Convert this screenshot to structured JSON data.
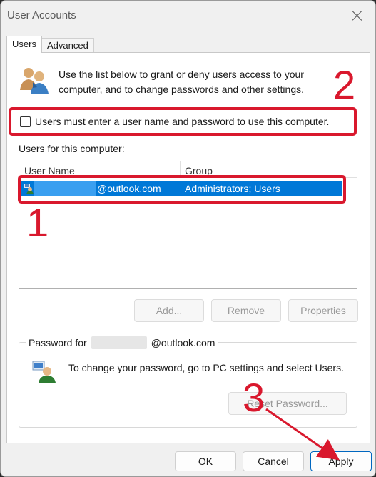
{
  "window": {
    "title": "User Accounts"
  },
  "tabs": [
    {
      "label": "Users",
      "active": true
    },
    {
      "label": "Advanced",
      "active": false
    }
  ],
  "intro_text": "Use the list below to grant or deny users access to your computer, and to change passwords and other settings.",
  "checkbox": {
    "label": "Users must enter a user name and password to use this computer.",
    "checked": false
  },
  "users_label": "Users for this computer:",
  "table": {
    "columns": [
      "User Name",
      "Group"
    ],
    "rows": [
      {
        "user_name": "@outlook.com",
        "group": "Administrators; Users",
        "selected": true
      }
    ]
  },
  "buttons": {
    "add": "Add...",
    "remove": "Remove",
    "properties": "Properties"
  },
  "password_group": {
    "legend_prefix": "Password for",
    "legend_suffix": "@outlook.com",
    "text": "To change your password, go to PC settings and select Users.",
    "reset_button": "Reset Password..."
  },
  "footer": {
    "ok": "OK",
    "cancel": "Cancel",
    "apply": "Apply"
  },
  "annotations": {
    "one": "1",
    "two": "2",
    "three": "3"
  },
  "colors": {
    "annotation_red": "#d9182d",
    "selection_blue": "#0078d7"
  }
}
